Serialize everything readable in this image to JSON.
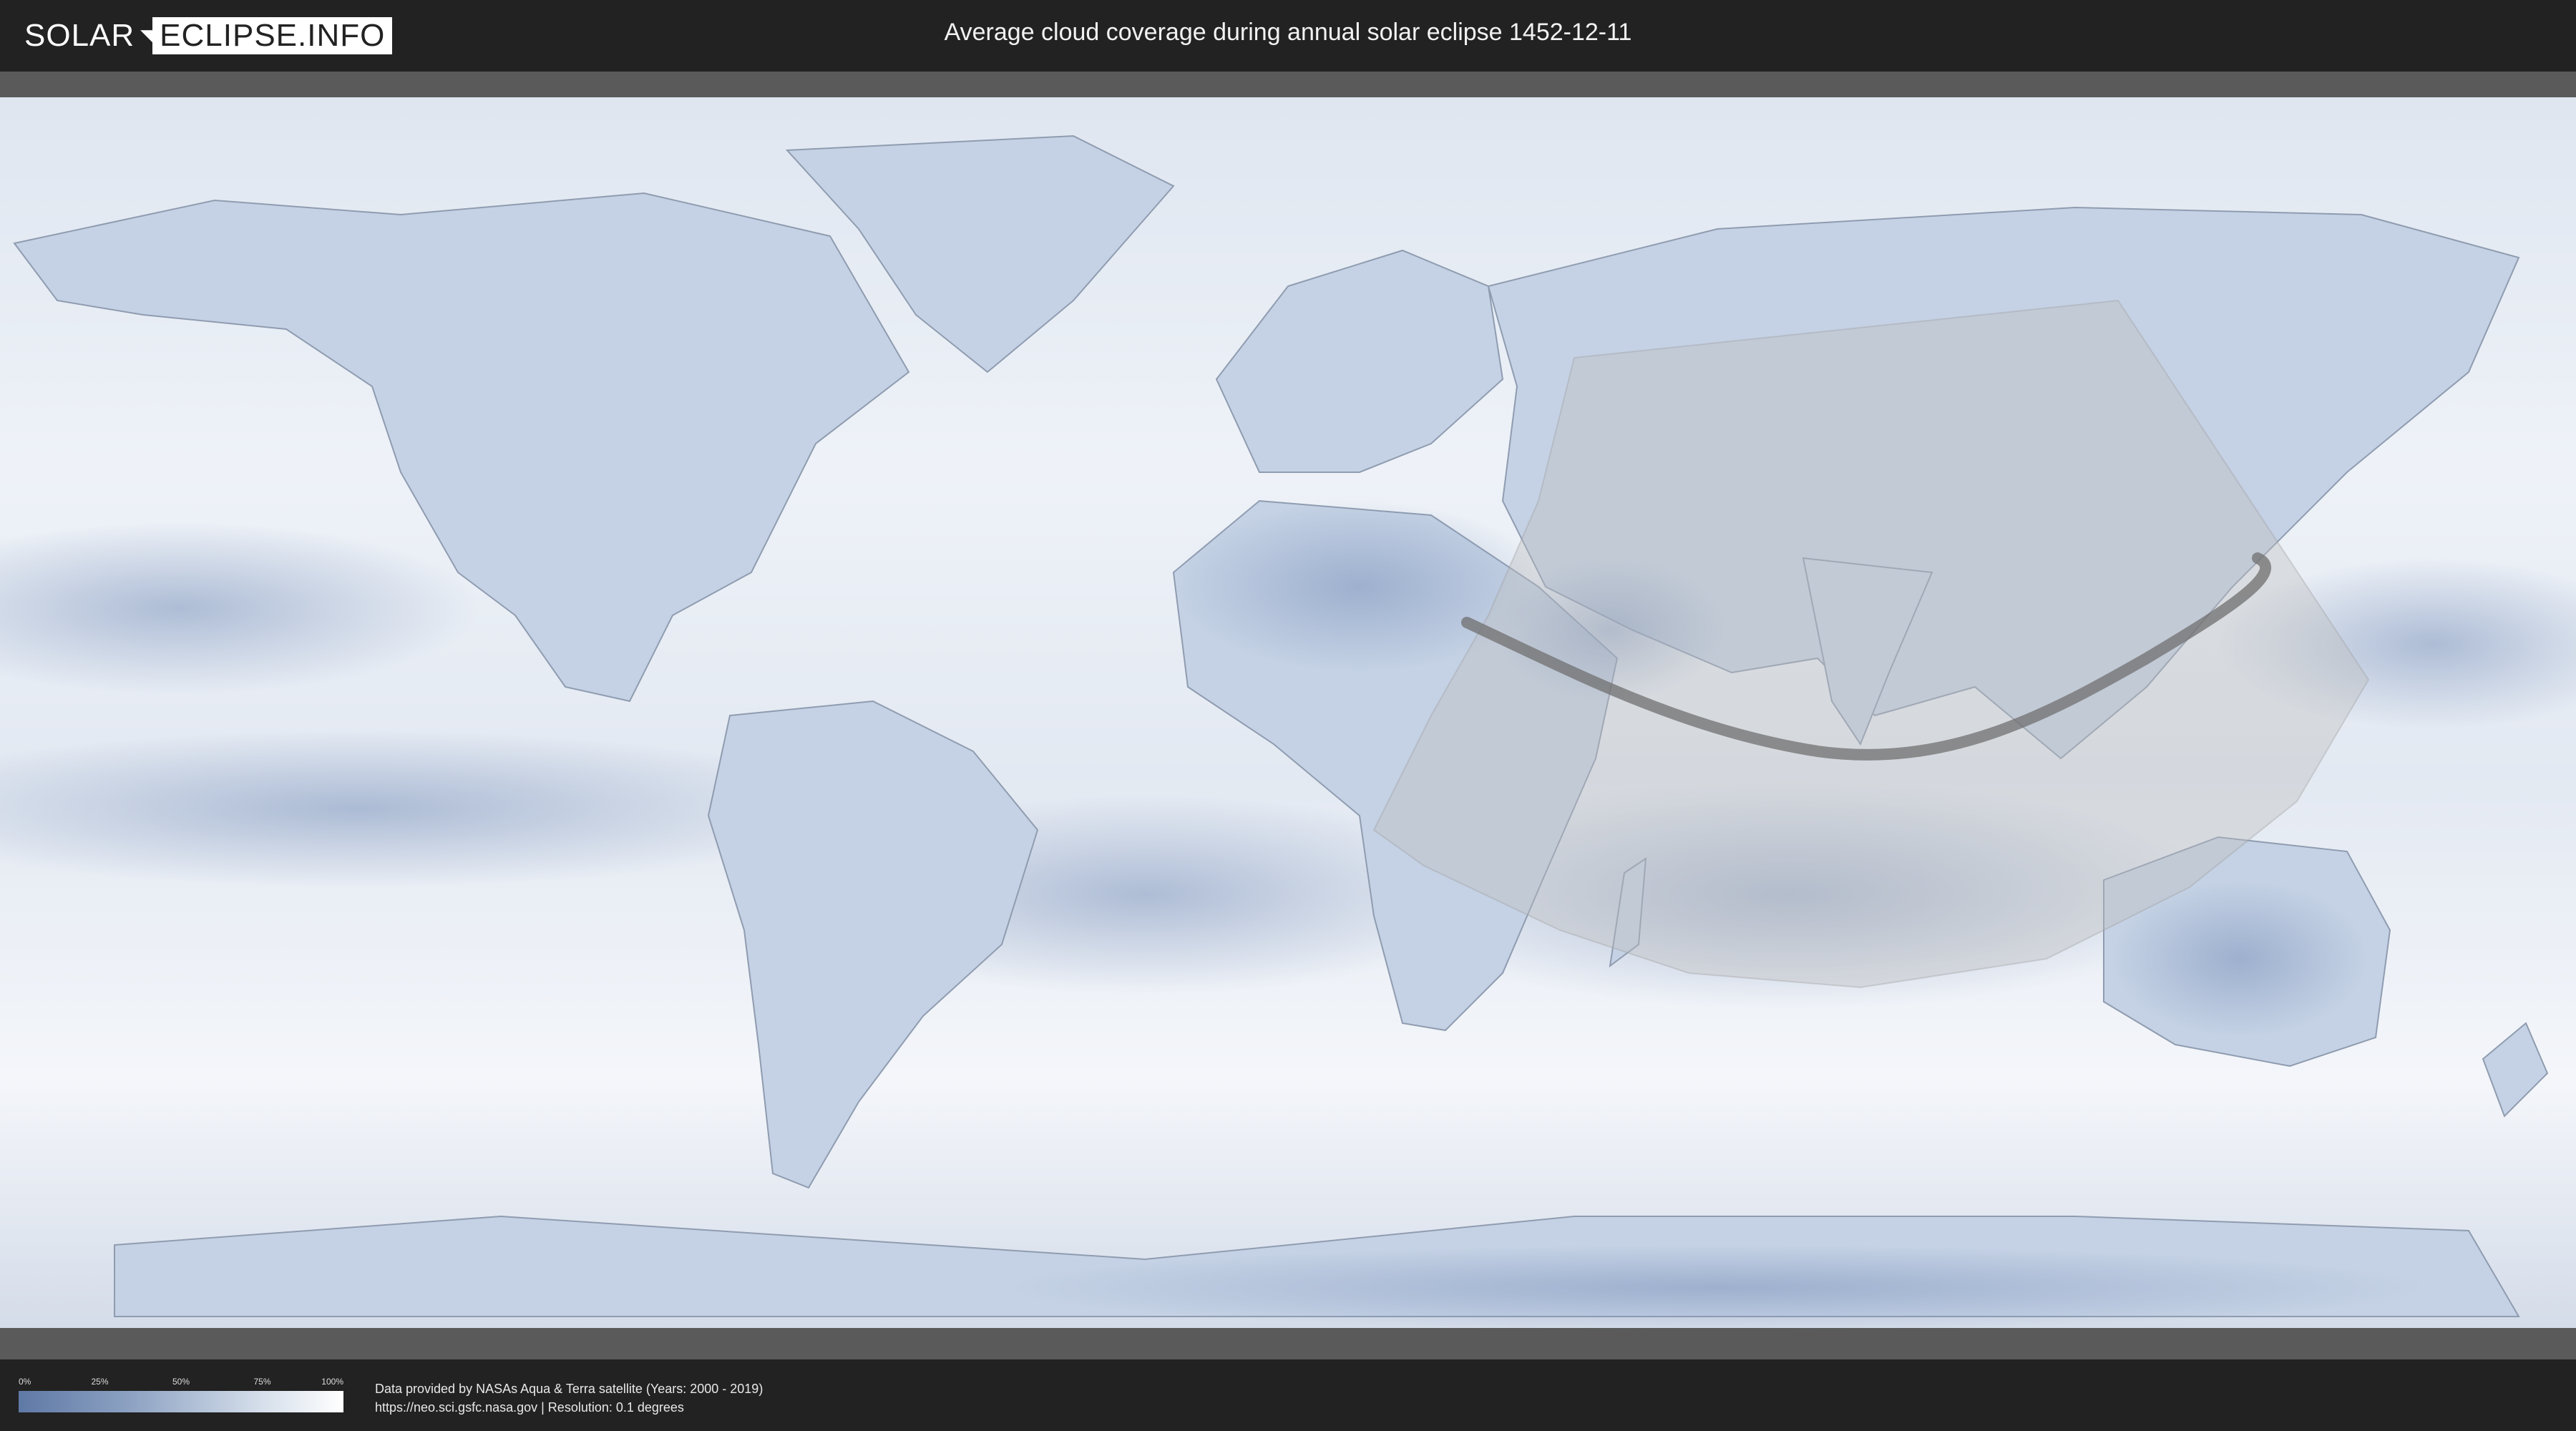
{
  "header": {
    "logo_solar": "SOLAR",
    "logo_eclipse": "ECLIPSE.INFO",
    "title": "Average cloud coverage during annual solar eclipse 1452-12-11"
  },
  "legend": {
    "ticks": [
      "0%",
      "25%",
      "50%",
      "75%",
      "100%"
    ],
    "low_color": "#5f79a6",
    "high_color": "#ffffff"
  },
  "credits": {
    "line1": "Data provided by NASAs Aqua & Terra satellite (Years: 2000 - 2019)",
    "line2": "https://neo.sci.gsfc.nasa.gov | Resolution: 0.1 degrees"
  },
  "map": {
    "projection": "equirectangular",
    "ocean_color": "#e9eef6",
    "land_color": "#c4d1e4",
    "eclipse_zone_color": "#bdbdbd",
    "central_path_color": "#6f6f6f"
  }
}
